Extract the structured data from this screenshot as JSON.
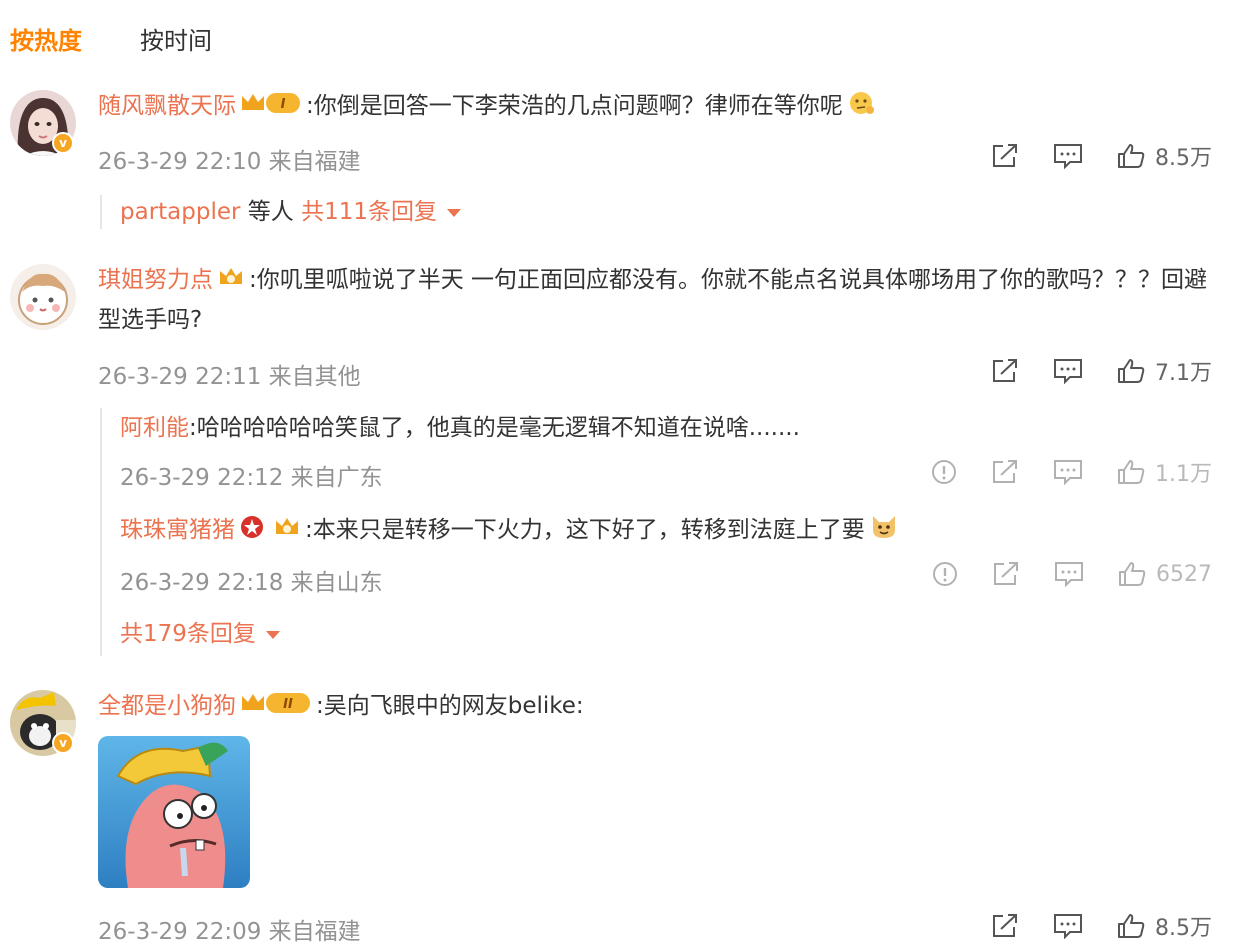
{
  "tabs": {
    "hot": "按热度",
    "time": "按时间"
  },
  "colors": {
    "accent": "#ff8200",
    "username": "#eb7350",
    "meta": "#939393"
  },
  "comments": [
    {
      "user": "随风飘散天际",
      "badge_roman": "I",
      "text": ":你倒是回答一下李荣浩的几点问题啊？律师在等你呢",
      "emoji": "thinking-emoji",
      "time": "26-3-29 22:10 来自福建",
      "likes": "8.5万",
      "replies_summary": {
        "user": "partappler",
        "mid": " 等人 ",
        "count": "共111条回复"
      }
    },
    {
      "user": "琪姐努力点",
      "text": ":你叽里呱啦说了半天 一句正面回应都没有。你就不能点名说具体哪场用了你的歌吗？？？回避型选手吗?",
      "time": "26-3-29 22:11 来自其他",
      "likes": "7.1万",
      "replies": [
        {
          "user": "阿利能",
          "text": ":哈哈哈哈哈哈笑鼠了，他真的是毫无逻辑不知道在说啥.......",
          "time": "26-3-29 22:12 来自广东",
          "likes": "1.1万"
        },
        {
          "user": "珠珠寓猪猪",
          "text": ":本来只是转移一下火力，这下好了，转移到法庭上了要",
          "emoji": "dog-emoji",
          "time": "26-3-29 22:18 来自山东",
          "likes": "6527"
        }
      ],
      "more_replies": "共179条回复"
    },
    {
      "user": "全都是小狗狗",
      "badge_roman": "II",
      "text": ":吴向飞眼中的网友belike:",
      "image": "patrick-star-meme",
      "time": "26-3-29 22:09 来自福建",
      "likes": "8.5万"
    }
  ]
}
